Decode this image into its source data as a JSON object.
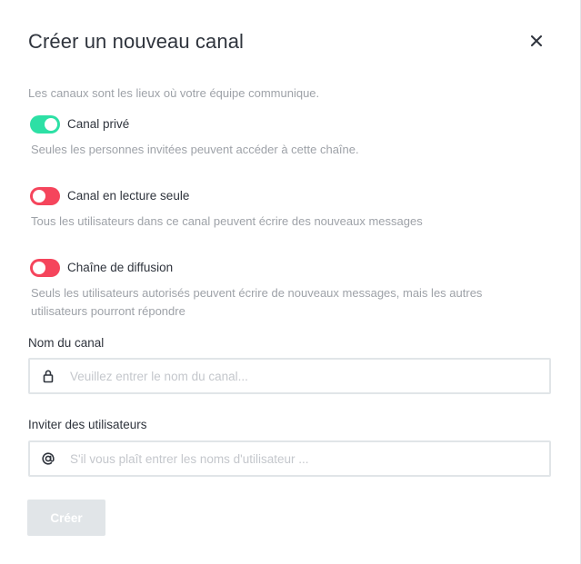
{
  "header": {
    "title": "Créer un nouveau canal",
    "close_icon": "close-icon"
  },
  "intro": "Les canaux sont les lieux où votre équipe communique.",
  "toggles": [
    {
      "label": "Canal privé",
      "state": "on",
      "help": "Seules les personnes invitées peuvent accéder à cette chaîne."
    },
    {
      "label": "Canal en lecture seule",
      "state": "off",
      "help": "Tous les utilisateurs dans ce canal peuvent écrire des nouveaux messages"
    },
    {
      "label": "Chaîne de diffusion",
      "state": "off",
      "help": "Seuls les utilisateurs autorisés peuvent écrire de nouveaux messages, mais les autres utilisateurs pourront répondre"
    }
  ],
  "channel_name": {
    "label": "Nom du canal",
    "placeholder": "Veuillez entrer le nom du canal...",
    "value": "",
    "icon": "lock-icon"
  },
  "invite_users": {
    "label": "Inviter des utilisateurs",
    "placeholder": "S'il vous plaît entrer les noms d'utilisateur ...",
    "value": "",
    "icon": "at-icon"
  },
  "actions": {
    "create_label": "Créer",
    "create_enabled": false
  },
  "colors": {
    "toggle_on": "#2de0a5",
    "toggle_off": "#f5455c",
    "muted_text": "#9ea2a8",
    "disabled_button": "#e1e5e8"
  }
}
